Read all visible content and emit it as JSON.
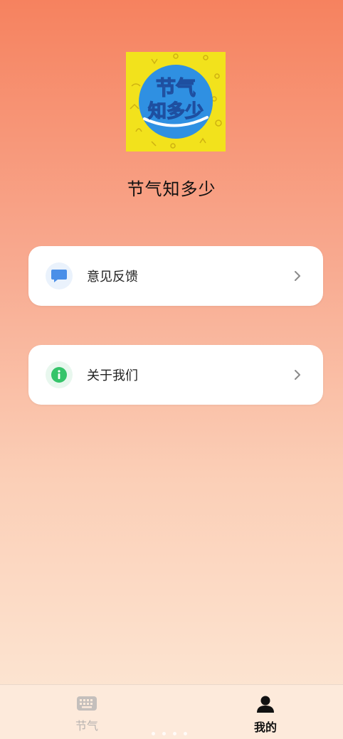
{
  "app": {
    "logo_line1": "节气",
    "logo_line2": "知多少",
    "name": "节气知多少"
  },
  "menu": [
    {
      "label": "意见反馈",
      "icon": "chat-bubble-icon",
      "color": "#4a8fe8"
    },
    {
      "label": "关于我们",
      "icon": "info-icon",
      "color": "#35c46a"
    }
  ],
  "tabbar": {
    "tabs": [
      {
        "label": "节气",
        "icon": "keyboard-icon",
        "active": false
      },
      {
        "label": "我的",
        "icon": "person-icon",
        "active": true
      }
    ]
  },
  "colors": {
    "bg_top": "#f6825f",
    "bg_bottom": "#fde9d7",
    "logo_bg": "#f2e21c",
    "logo_circle": "#2f90e2",
    "tab_inactive": "#b8b3b0",
    "tab_active": "#111111"
  }
}
